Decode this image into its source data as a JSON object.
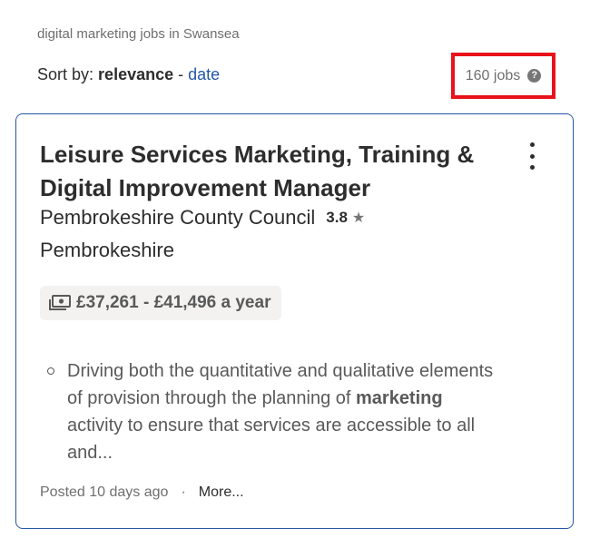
{
  "search": {
    "query_text": "digital marketing jobs in Swansea"
  },
  "sort": {
    "label": "Sort by:",
    "active": "relevance",
    "separator": "-",
    "other": "date"
  },
  "results": {
    "count_text": "160 jobs",
    "help_icon": "question-circle-icon",
    "highlight_color": "#e8121a"
  },
  "job": {
    "title": "Leisure Services Marketing, Training & Digital Improvement Manager",
    "company": "Pembrokeshire County Council",
    "rating": "3.8",
    "rating_icon": "star-icon",
    "location": "Pembrokeshire",
    "salary": "£37,261 - £41,496 a year",
    "salary_icon": "money-icon",
    "snippet": {
      "before": "Driving both the quantitative and qualitative elements of provision through the planning of ",
      "highlight": "marketing",
      "after": " activity to ensure that services are accessible to all and..."
    },
    "posted": "Posted 10 days ago",
    "separator": "·",
    "more_label": "More...",
    "menu_icon": "kebab-menu-icon"
  },
  "colors": {
    "link": "#2557a7",
    "card_border": "#2557a7",
    "text": "#2d2d2d",
    "muted": "#6f6f6f"
  }
}
